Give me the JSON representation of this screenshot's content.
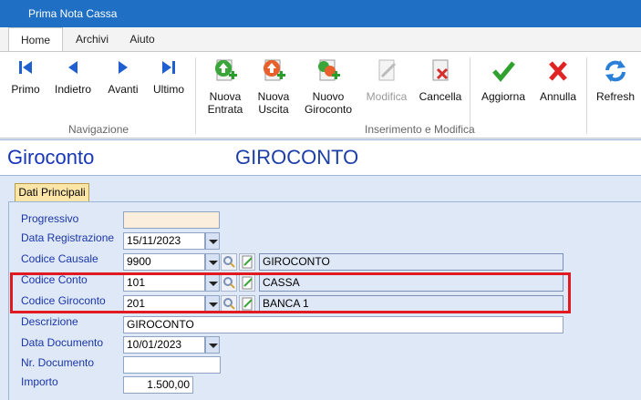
{
  "window": {
    "title": "Prima Nota Cassa"
  },
  "ribbon_tabs": [
    "Home",
    "Archivi",
    "Aiuto"
  ],
  "nav": {
    "first": "Primo",
    "prev": "Indietro",
    "next": "Avanti",
    "last": "Ultimo",
    "group_label": "Navigazione"
  },
  "edit": {
    "new_income_1": "Nuova",
    "new_income_2": "Entrata",
    "new_expense_1": "Nuova",
    "new_expense_2": "Uscita",
    "new_transfer_1": "Nuovo",
    "new_transfer_2": "Giroconto",
    "modify": "Modifica",
    "delete": "Cancella",
    "update": "Aggiorna",
    "cancel": "Annulla",
    "refresh": "Refresh",
    "group_label": "Inserimento e Modifica"
  },
  "header": {
    "left": "Giroconto",
    "center": "GIROCONTO"
  },
  "page_tab": "Dati Principali",
  "form": {
    "progressivo": {
      "label": "Progressivo",
      "value": ""
    },
    "data_registrazione": {
      "label": "Data Registrazione",
      "value": "15/11/2023"
    },
    "codice_causale": {
      "label": "Codice Causale",
      "value": "9900",
      "desc": "GIROCONTO"
    },
    "codice_conto": {
      "label": "Codice Conto",
      "value": "101",
      "desc": "CASSA"
    },
    "codice_giroconto": {
      "label": "Codice Giroconto",
      "value": "201",
      "desc": "BANCA 1"
    },
    "descrizione": {
      "label": "Descrizione",
      "value": "GIROCONTO"
    },
    "data_documento": {
      "label": "Data Documento",
      "value": "10/01/2023"
    },
    "nr_documento": {
      "label": "Nr. Documento",
      "value": ""
    },
    "importo": {
      "label": "Importo",
      "value": "1.500,00"
    }
  },
  "colors": {
    "titlebar": "#1f6fc5",
    "accent_blue": "#1636b8",
    "highlight": "#e11a22",
    "panel": "#dfe8f6"
  }
}
